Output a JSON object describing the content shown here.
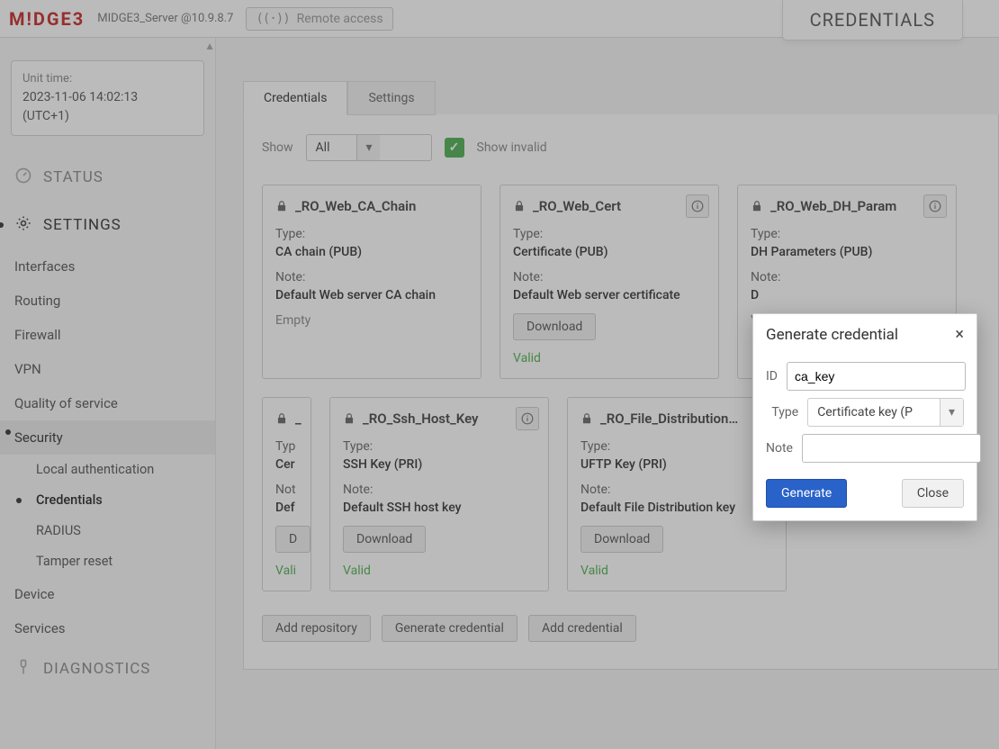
{
  "topbar": {
    "brand": "M!DGE3",
    "server": "MIDGE3_Server @10.9.8.7",
    "remote_icon_text": "((·))",
    "remote": "Remote access",
    "breadcrumb": "CREDENTIALS"
  },
  "unit_time": {
    "label": "Unit time:",
    "value1": "2023-11-06 14:02:13",
    "value2": "(UTC+1)"
  },
  "nav": {
    "status": "STATUS",
    "settings": "SETTINGS",
    "items": {
      "interfaces": "Interfaces",
      "routing": "Routing",
      "firewall": "Firewall",
      "vpn": "VPN",
      "qos": "Quality of service",
      "security": "Security",
      "device": "Device",
      "services": "Services"
    },
    "security_sub": {
      "local_auth": "Local authentication",
      "credentials": "Credentials",
      "radius": "RADIUS",
      "tamper": "Tamper reset"
    },
    "diagnostics": "DIAGNOSTICS"
  },
  "tabs": {
    "credentials": "Credentials",
    "settings": "Settings"
  },
  "toolbar": {
    "show": "Show",
    "filter": "All",
    "show_invalid": "Show invalid"
  },
  "cards": [
    {
      "name": "_RO_Web_CA_Chain",
      "type_label": "Type:",
      "type": "CA chain (PUB)",
      "note_label": "Note:",
      "note": "Default Web server CA chain",
      "status": "Empty",
      "status_class": "empty",
      "download": "",
      "info": false
    },
    {
      "name": "_RO_Web_Cert",
      "type_label": "Type:",
      "type": "Certificate (PUB)",
      "note_label": "Note:",
      "note": "Default Web server certificate",
      "download": "Download",
      "status": "Valid",
      "status_class": "valid",
      "info": true
    },
    {
      "name": "_RO_Web_DH_Param",
      "type_label": "Type:",
      "type": "DH Parameters (PUB)",
      "note_label": "Note:",
      "note": "D",
      "download": "",
      "status": "V",
      "status_class": "valid",
      "info": true
    },
    {
      "name": "_",
      "type_label": "Typ",
      "type": "Cer",
      "note_label": "Not",
      "note": "Def",
      "download": "D",
      "status": "Vali",
      "status_class": "valid",
      "info": false
    },
    {
      "name": "_RO_Ssh_Host_Key",
      "type_label": "Type:",
      "type": "SSH Key (PRI)",
      "note_label": "Note:",
      "note": "Default SSH host key",
      "download": "Download",
      "status": "Valid",
      "status_class": "valid",
      "info": true
    },
    {
      "name": "_RO_File_Distribution…",
      "type_label": "Type:",
      "type": "UFTP Key (PRI)",
      "note_label": "Note:",
      "note": "Default File Distribution key",
      "download": "Download",
      "status": "Valid",
      "status_class": "valid",
      "info": true
    }
  ],
  "actions": {
    "add_repo": "Add repository",
    "gen_cred": "Generate credential",
    "add_cred": "Add credential"
  },
  "modal": {
    "title": "Generate credential",
    "id_label": "ID",
    "id_value": "ca_key",
    "type_label": "Type",
    "type_value": "Certificate key (P",
    "note_label": "Note",
    "note_value": "",
    "generate": "Generate",
    "close": "Close"
  }
}
